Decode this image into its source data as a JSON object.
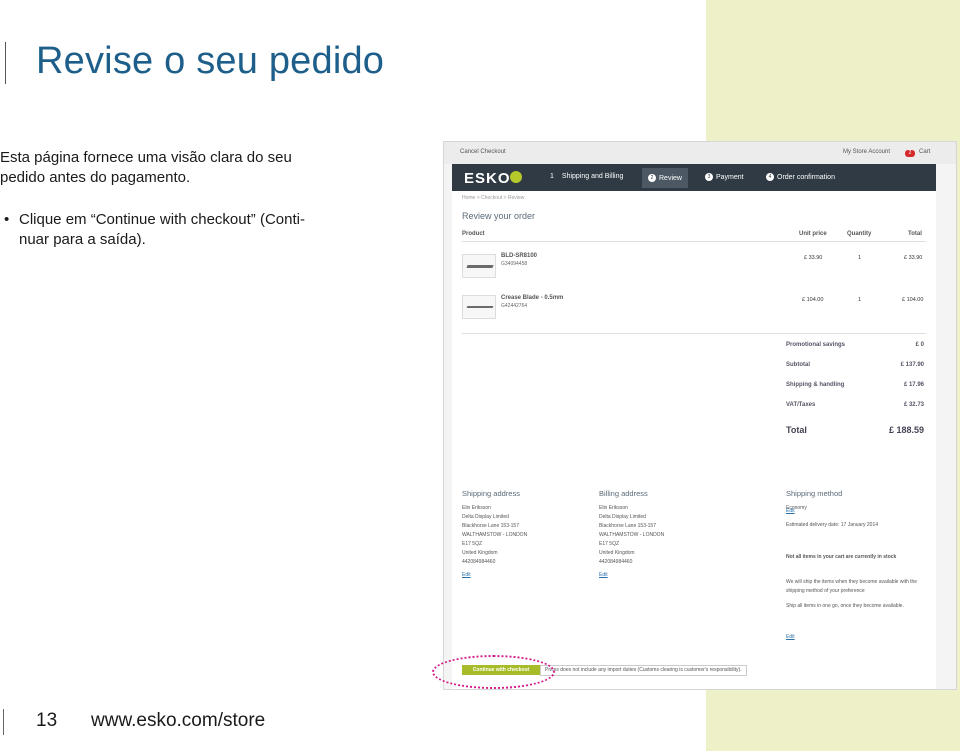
{
  "page": {
    "title": "Revise o seu pedido",
    "intro": "Esta página fornece uma visão clara do seu pedido antes do pagamento.",
    "bullet_line1": "Clique em “Continue with checkout” (Conti-",
    "bullet_line2": "nuar para a saída).",
    "page_number": "13",
    "url": "www.esko.com/store",
    "accent_color": "#eef0c8",
    "title_color": "#1d5f8a"
  },
  "screenshot": {
    "topbar": {
      "cancel": "Cancel Checkout",
      "account": "My Store Account",
      "cart_count": "2",
      "cart": "Cart"
    },
    "logo": "ESKO",
    "steps": [
      {
        "num": "1",
        "label": "Shipping and Billing"
      },
      {
        "num": "2",
        "label": "Review"
      },
      {
        "num": "3",
        "label": "Payment"
      },
      {
        "num": "4",
        "label": "Order confirmation"
      }
    ],
    "breadcrumb": "Home  >  Checkout  >  Review",
    "review_title": "Review your order",
    "headers": {
      "product": "Product",
      "unit_price": "Unit price",
      "quantity": "Quantity",
      "total": "Total"
    },
    "items": [
      {
        "name": "BLD-SR8100",
        "sku": "G34094458",
        "unit_price": "£ 33.90",
        "quantity": "1",
        "total": "£ 33.90"
      },
      {
        "name": "Crease Blade - 0.5mm",
        "sku": "G42442764",
        "unit_price": "£ 104.00",
        "quantity": "1",
        "total": "£ 104.00"
      }
    ],
    "summary": [
      {
        "label": "Promotional savings",
        "value": "£ 0"
      },
      {
        "label": "Subtotal",
        "value": "£ 137.90"
      },
      {
        "label": "Shipping & handling",
        "value": "£ 17.96"
      },
      {
        "label": "VAT/Taxes",
        "value": "£ 32.73"
      }
    ],
    "total": {
      "label": "Total",
      "value": "£ 188.59"
    },
    "shipping_address": {
      "title": "Shipping address",
      "lines": [
        "Elin Eriksson",
        "Delta Display Limited",
        "Blackhorse Lane 153-157",
        "WALTHAMSTOW - LONDON",
        "E17 5QZ",
        "United Kingdom",
        "442084984460"
      ],
      "edit": "Edit"
    },
    "billing_address": {
      "title": "Billing address",
      "lines": [
        "Elin Eriksson",
        "Delta Display Limited",
        "Blackhorse Lane 153-157",
        "WALTHAMSTOW - LONDON",
        "E17 5QZ",
        "United Kingdom",
        "442084984460"
      ],
      "edit": "Edit"
    },
    "shipping_method": {
      "title": "Shipping method",
      "method": "Economy",
      "edit1": "Edit",
      "delivery": "Estimated delivery date: 17 January 2014",
      "notice": "Not all items in your cart are currently in stock",
      "option1": "We will ship the items when they become available with the shipping method of your preference",
      "option2": "Ship all items in one go, once they become available.",
      "edit2": "Edit"
    },
    "continue_button": "Continue with checkout",
    "price_note": "Prices does not include any import duties (Customs clearing is customer's responsibility)."
  }
}
